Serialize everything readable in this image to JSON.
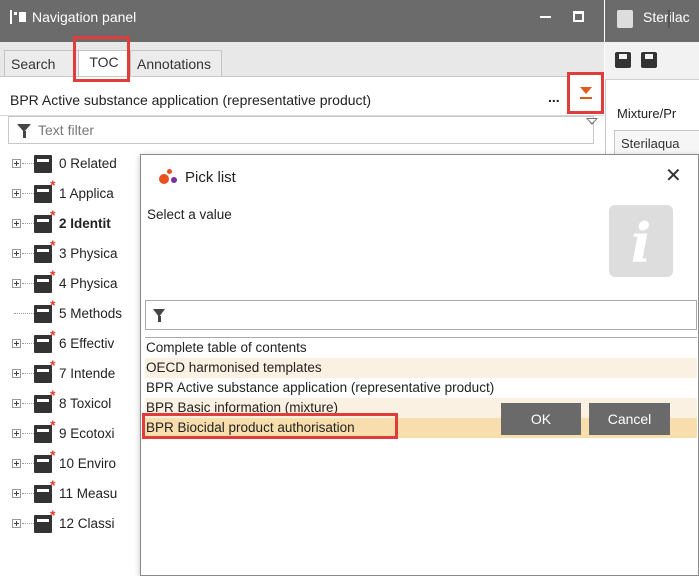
{
  "nav_panel": {
    "title": "Navigation panel",
    "tabs": [
      {
        "label": "Search"
      },
      {
        "label": "TOC"
      },
      {
        "label": "Annotations"
      }
    ],
    "toc_selection": "BPR Active substance application (representative product)",
    "more_label": "...",
    "filter_placeholder": "Text filter",
    "tree_items": [
      {
        "label": "0 Related",
        "star": false,
        "bold": false
      },
      {
        "label": "1 Applica",
        "star": true,
        "bold": false
      },
      {
        "label": "2 Identit",
        "star": true,
        "bold": true
      },
      {
        "label": "3 Physica",
        "star": true,
        "bold": false
      },
      {
        "label": "4 Physica",
        "star": true,
        "bold": false
      },
      {
        "label": "5 Methods",
        "star": true,
        "bold": false
      },
      {
        "label": "6 Effectiv",
        "star": true,
        "bold": false
      },
      {
        "label": "7 Intende",
        "star": true,
        "bold": false
      },
      {
        "label": "8 Toxicol",
        "star": true,
        "bold": false
      },
      {
        "label": "9 Ecotoxi",
        "star": true,
        "bold": false
      },
      {
        "label": "10 Enviro",
        "star": true,
        "bold": false
      },
      {
        "label": "11 Measu",
        "star": true,
        "bold": false
      },
      {
        "label": "12 Classi",
        "star": true,
        "bold": false
      }
    ]
  },
  "right_panel": {
    "title": "Sterilac",
    "mixture_label": "Mixture/Pr",
    "mixture_value": "Sterilaqua"
  },
  "dialog": {
    "title": "Pick list",
    "close_label": "✕",
    "prompt": "Select a value",
    "info_glyph": "i",
    "options": [
      {
        "label": "Complete table of contents",
        "state": "normal"
      },
      {
        "label": "OECD harmonised templates",
        "state": "alt"
      },
      {
        "label": "BPR Active substance application (representative product)",
        "state": "normal"
      },
      {
        "label": "BPR Basic information (mixture)",
        "state": "alt"
      },
      {
        "label": "BPR Biocidal product authorisation",
        "state": "selected"
      }
    ],
    "ok_label": "OK",
    "cancel_label": "Cancel"
  },
  "colors": {
    "header_bg": "#6b6b6b",
    "highlight_border": "#e03c3c",
    "dropdown_arrow": "#e05a1e",
    "selected_row": "#f8deac",
    "alt_row": "#fbf1e2",
    "required_star": "#e04030"
  }
}
